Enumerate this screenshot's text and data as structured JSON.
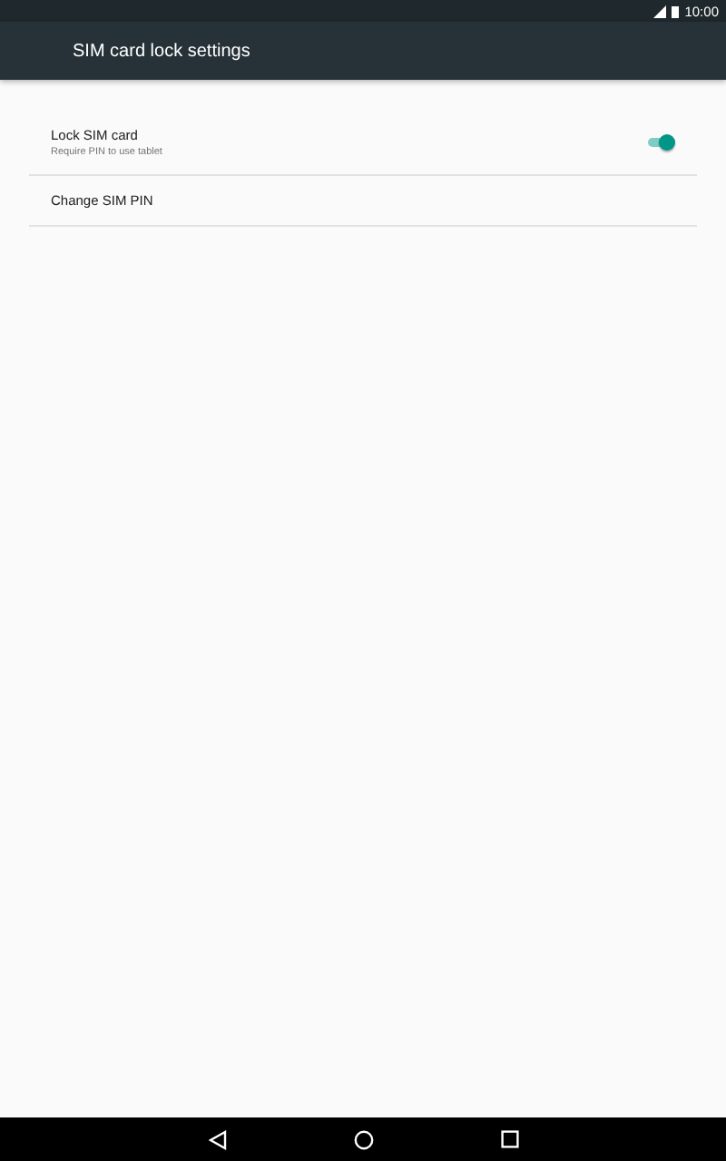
{
  "status_bar": {
    "time": "10:00"
  },
  "app_bar": {
    "title": "SIM card lock settings"
  },
  "settings": [
    {
      "kind": "switch",
      "title": "Lock SIM card",
      "summary": "Require PIN to use tablet",
      "on": true
    },
    {
      "kind": "plain",
      "title": "Change SIM PIN"
    }
  ]
}
